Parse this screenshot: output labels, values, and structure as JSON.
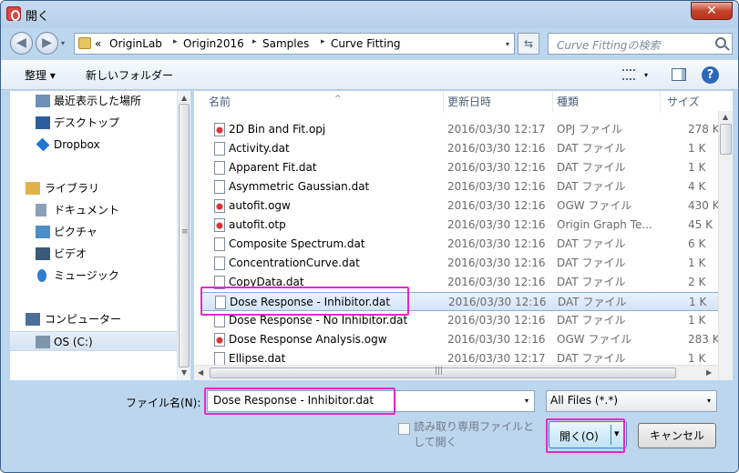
{
  "window": {
    "title": "開く",
    "close_glyph": "✕"
  },
  "nav_buttons": {
    "back_glyph": "◀",
    "forward_glyph": "▶",
    "drop_glyph": "▾"
  },
  "address": {
    "overflow": "«",
    "crumbs": [
      "OriginLab",
      "Origin2016",
      "Samples",
      "Curve Fitting"
    ],
    "sep_glyph": "▸",
    "drop_glyph": "▾",
    "refresh_glyph": "⇆"
  },
  "search": {
    "placeholder": "Curve Fittingの検索"
  },
  "toolbar": {
    "organize": "整理 ▾",
    "new_folder": "新しいフォルダー",
    "view_drop": "▾",
    "help": "?"
  },
  "nav": {
    "items": [
      {
        "label": "最近表示した場所",
        "icon": "recent-places-icon",
        "color": "#6d8fb8"
      },
      {
        "label": "デスクトップ",
        "icon": "desktop-icon",
        "color": "#2d5d9a"
      },
      {
        "label": "Dropbox",
        "icon": "dropbox-icon",
        "color": "#1f76d0"
      },
      {
        "label": "ライブラリ",
        "icon": "library-icon",
        "color": "#e0b24a"
      },
      {
        "label": "ドキュメント",
        "icon": "documents-icon",
        "color": "#8aa0b8"
      },
      {
        "label": "ピクチャ",
        "icon": "pictures-icon",
        "color": "#4f8fc8"
      },
      {
        "label": "ビデオ",
        "icon": "videos-icon",
        "color": "#3a5a7a"
      },
      {
        "label": "ミュージック",
        "icon": "music-icon",
        "color": "#2f7dd1"
      },
      {
        "label": "コンピューター",
        "icon": "computer-icon",
        "color": "#4d6f99"
      },
      {
        "label": "OS (C:)",
        "icon": "drive-icon",
        "color": "#7f95ab"
      }
    ]
  },
  "columns": {
    "name": "名前",
    "date": "更新日時",
    "type": "種類",
    "size": "サイズ",
    "sort_glyph": "^"
  },
  "files": [
    {
      "name": "2D Bin and Fit.opj",
      "date": "2016/03/30 12:17",
      "type": "OPJ ファイル",
      "size": "278 K",
      "icon": "origin-project-icon"
    },
    {
      "name": "Activity.dat",
      "date": "2016/03/30 12:16",
      "type": "DAT ファイル",
      "size": "1 K",
      "icon": "dat-file-icon"
    },
    {
      "name": "Apparent Fit.dat",
      "date": "2016/03/30 12:16",
      "type": "DAT ファイル",
      "size": "1 K",
      "icon": "dat-file-icon"
    },
    {
      "name": "Asymmetric Gaussian.dat",
      "date": "2016/03/30 12:16",
      "type": "DAT ファイル",
      "size": "4 K",
      "icon": "dat-file-icon"
    },
    {
      "name": "autofit.ogw",
      "date": "2016/03/30 12:16",
      "type": "OGW ファイル",
      "size": "430 K",
      "icon": "origin-workbook-icon"
    },
    {
      "name": "autofit.otp",
      "date": "2016/03/30 12:16",
      "type": "Origin Graph Te...",
      "size": "45 K",
      "icon": "origin-template-icon"
    },
    {
      "name": "Composite Spectrum.dat",
      "date": "2016/03/30 12:16",
      "type": "DAT ファイル",
      "size": "6 K",
      "icon": "dat-file-icon"
    },
    {
      "name": "ConcentrationCurve.dat",
      "date": "2016/03/30 12:16",
      "type": "DAT ファイル",
      "size": "1 K",
      "icon": "dat-file-icon"
    },
    {
      "name": "CopyData.dat",
      "date": "2016/03/30 12:16",
      "type": "DAT ファイル",
      "size": "2 K",
      "icon": "dat-file-icon"
    },
    {
      "name": "Dose Response - Inhibitor.dat",
      "date": "2016/03/30 12:16",
      "type": "DAT ファイル",
      "size": "1 K",
      "icon": "dat-file-icon"
    },
    {
      "name": "Dose Response - No Inhibitor.dat",
      "date": "2016/03/30 12:16",
      "type": "DAT ファイル",
      "size": "1 K",
      "icon": "dat-file-icon"
    },
    {
      "name": "Dose Response Analysis.ogw",
      "date": "2016/03/30 12:16",
      "type": "OGW ファイル",
      "size": "283 K",
      "icon": "origin-workbook-icon"
    },
    {
      "name": "Ellipse.dat",
      "date": "2016/03/30 12:17",
      "type": "DAT ファイル",
      "size": "1 K",
      "icon": "dat-file-icon"
    }
  ],
  "selected_index": 9,
  "scroll": {
    "up": "▲",
    "down": "▼",
    "left": "◀",
    "right": "▶",
    "grip": "≡",
    "hgrip": "|||"
  },
  "bottom": {
    "filename_label": "ファイル名(N):",
    "filename_value": "Dose Response - Inhibitor.dat",
    "filename_drop": "▾",
    "filter_value": "All Files (*.*)",
    "filter_drop": "▾",
    "readonly_label": "読み取り専用ファイルとして開く",
    "open_label": "開く(O)",
    "open_drop": "▾",
    "cancel_label": "キャンセル"
  },
  "colors": {
    "highlight": "#e629c7",
    "selection_border": "#84acdd",
    "window_frame": "#bcd6ee"
  }
}
